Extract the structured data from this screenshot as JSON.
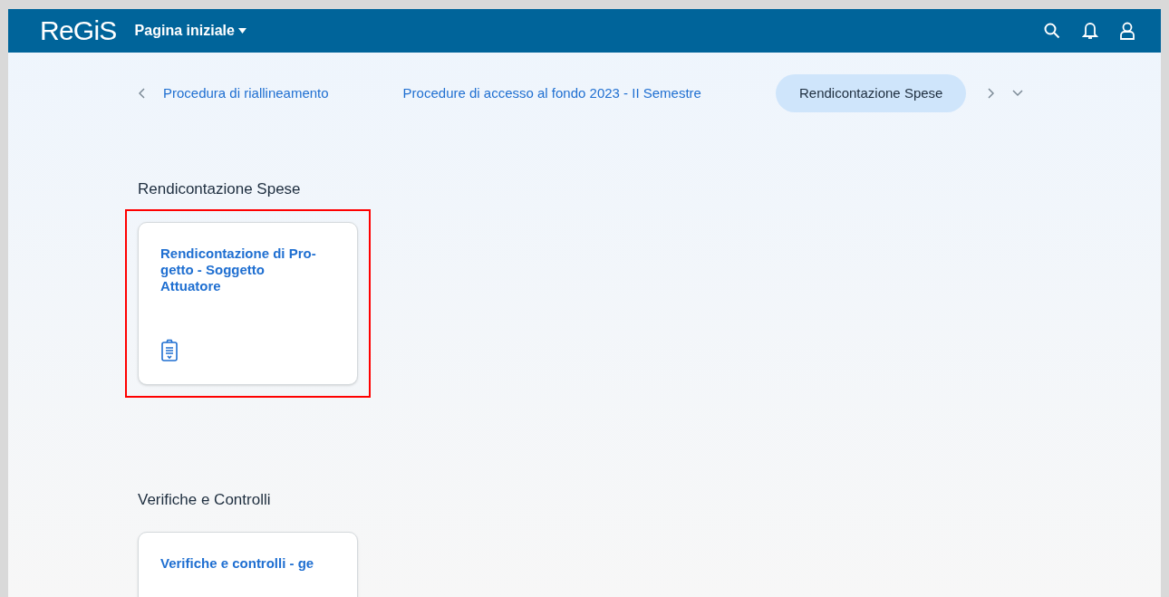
{
  "header": {
    "logo": "ReGiS",
    "menu": "Pagina iniziale"
  },
  "breadcrumb": [
    {
      "label": "Procedura di riallineamento",
      "selected": false
    },
    {
      "label": "Procedure di accesso al fondo 2023 - II Semestre",
      "selected": false
    },
    {
      "label": "Rendicontazione Spese",
      "selected": true
    }
  ],
  "sections": [
    {
      "title": "Rendicontazione Spese",
      "tiles": [
        {
          "title": "Rendicontazione di Pro-getto - Soggetto Attuatore",
          "highlighted": true,
          "kind": "with-icon"
        }
      ]
    },
    {
      "title": "Verifiche e Controlli",
      "tiles": [
        {
          "title": "Verifiche e controlli - ge",
          "highlighted": false,
          "kind": "plain"
        }
      ]
    }
  ]
}
